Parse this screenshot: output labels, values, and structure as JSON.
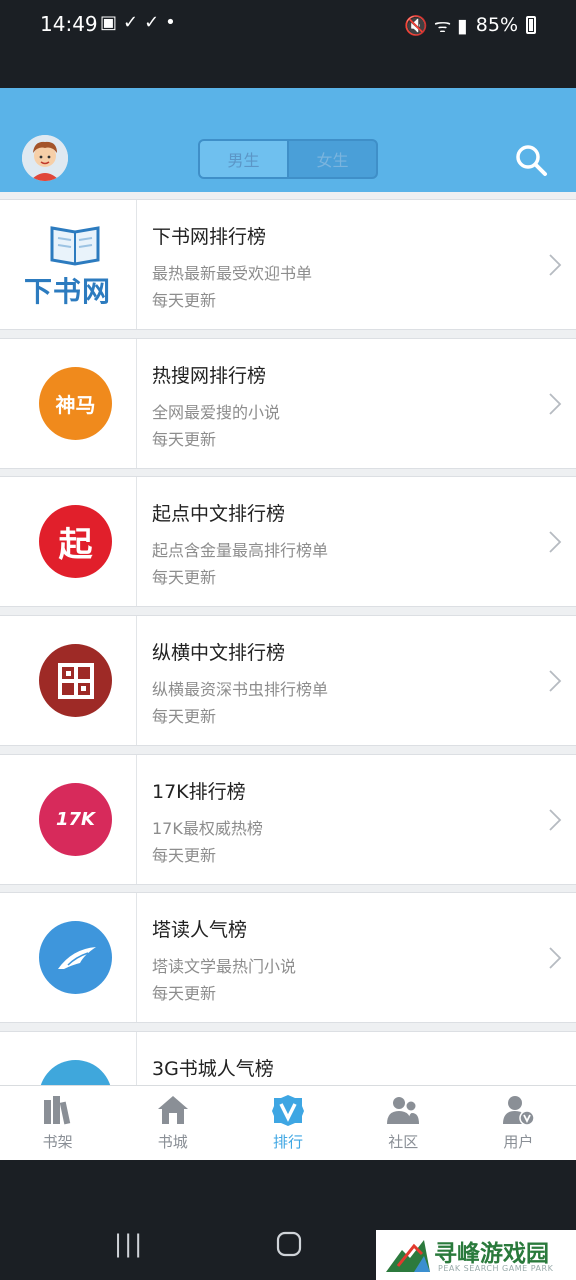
{
  "status_bar": {
    "time": "14:49",
    "left_icons": "▣✓✓•",
    "right_icons": "🔇 ᯤ ▮",
    "battery": "85%"
  },
  "header": {
    "gender_tabs": [
      {
        "label": "男生",
        "active": true
      },
      {
        "label": "女生",
        "active": false
      }
    ]
  },
  "rankings": [
    {
      "title": "下书网排行榜",
      "desc": "最热最新最受欢迎书单",
      "freq": "每天更新",
      "logo_text": "下书网",
      "logo_color": "#ffffff",
      "logo_icon": "book-logo-icon"
    },
    {
      "title": "热搜网排行榜",
      "desc": "全网最爱搜的小说",
      "freq": "每天更新",
      "logo_text": "神马",
      "logo_color": "#f08a1c",
      "logo_icon": "shenma-logo-icon"
    },
    {
      "title": "起点中文排行榜",
      "desc": "起点含金量最高排行榜单",
      "freq": "每天更新",
      "logo_text": "起",
      "logo_color": "#e11f2b",
      "logo_icon": "qidian-logo-icon"
    },
    {
      "title": "纵横中文排行榜",
      "desc": "纵横最资深书虫排行榜单",
      "freq": "每天更新",
      "logo_text": "",
      "logo_color": "#9e2a26",
      "logo_icon": "zongheng-logo-icon"
    },
    {
      "title": "17K排行榜",
      "desc": "17K最权威热榜",
      "freq": "每天更新",
      "logo_text": "17K",
      "logo_color": "#d72a5b",
      "logo_icon": "17k-logo-icon"
    },
    {
      "title": "塔读人气榜",
      "desc": "塔读文学最热门小说",
      "freq": "每天更新",
      "logo_text": "",
      "logo_color": "#3e96dc",
      "logo_icon": "tadu-logo-icon"
    },
    {
      "title": "3G书城人气榜",
      "desc": "",
      "freq": "",
      "logo_text": "",
      "logo_color": "#3fa7dc",
      "logo_icon": "3g-logo-icon"
    }
  ],
  "bottom_nav": [
    {
      "label": "书架",
      "icon": "bookshelf-icon",
      "active": false
    },
    {
      "label": "书城",
      "icon": "home-icon",
      "active": false
    },
    {
      "label": "排行",
      "icon": "ranking-v-icon",
      "active": true
    },
    {
      "label": "社区",
      "icon": "community-icon",
      "active": false
    },
    {
      "label": "用户",
      "icon": "user-icon",
      "active": false
    }
  ],
  "system_nav": {
    "recents": "|||",
    "home": "▢"
  },
  "watermark": {
    "title": "寻峰游戏园",
    "subtitle": "PEAK SEARCH GAME PARK"
  },
  "colors": {
    "header": "#5ab3e8",
    "accent": "#3ea6e3",
    "inactive": "#8a8f96"
  }
}
